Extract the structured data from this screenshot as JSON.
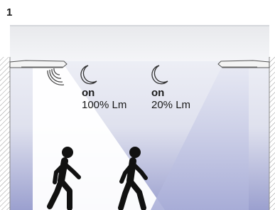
{
  "panel": {
    "number": "1"
  },
  "luminaires": [
    {
      "state": "on",
      "level": "100% Lm",
      "sensor_icon": "motion-sensor-icon",
      "mode_icon": "crescent-moon-icon"
    },
    {
      "state": "on",
      "level": "20% Lm",
      "mode_icon": "crescent-moon-icon"
    }
  ],
  "people": {
    "icon": "walking-person-icon",
    "count": 2
  },
  "colors": {
    "ceiling_top": "#e6e7ea",
    "room_background": "#f2f3f8",
    "floor_tint": "#9ba0cf",
    "bright_beam": "#ffffff",
    "dim_beam": "#b8bcdf",
    "wall_hatch": "#9a9a9a",
    "figure": "#111111"
  }
}
